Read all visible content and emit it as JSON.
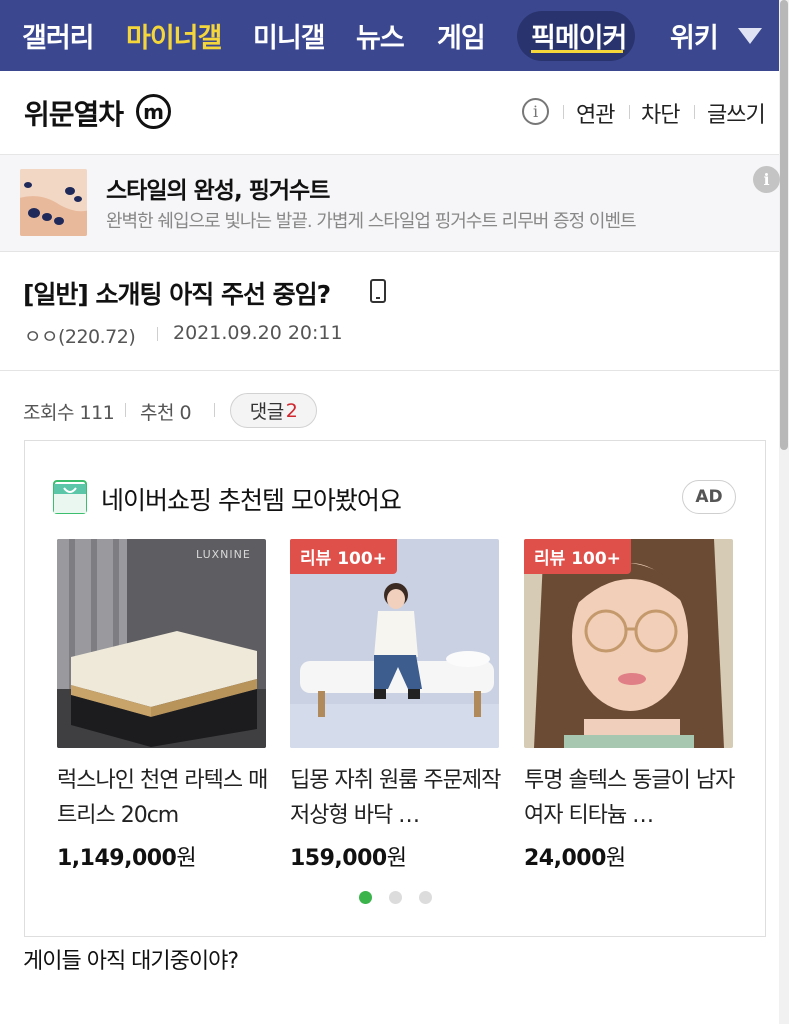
{
  "nav": {
    "items": [
      "갤러리",
      "마이너갤",
      "미니갤",
      "뉴스",
      "게임"
    ],
    "active_item": "마이너갤",
    "pick_label": "픽메이커",
    "wiki_label": "위키",
    "more_icon": "triangle-down-icon"
  },
  "header": {
    "title": "위문열차",
    "badge": "m",
    "links": [
      "연관",
      "차단",
      "글쓰기"
    ]
  },
  "ad_banner": {
    "title": "스타일의 완성, 핑거수트",
    "desc": "완벽한 쉐입으로 빛나는 발끝. 가볍게 스타일업 핑거수트 리무버 증정 이벤트",
    "info": "i"
  },
  "post": {
    "title": "[일반] 소개팅 아직 주선 중임?",
    "author": "ㅇㅇ(220.72)",
    "date": "2021.09.20 20:11",
    "views_label": "조회수 111",
    "recommend_label": "추천 0",
    "comments_label": "댓글",
    "comments_count": "2",
    "body": "게이들 아직 대기중이야?"
  },
  "shopping": {
    "title": "네이버쇼핑 추천템 모아봤어요",
    "ad_badge": "AD",
    "products": [
      {
        "name": "럭스나인 천연 라텍스 매트리스 20cm",
        "price": "1,149,000",
        "unit": "원",
        "brand": "LUXNINE",
        "review_tag": ""
      },
      {
        "name": "딥몽 자취 원룸 주문제작 저상형 바닥 …",
        "price": "159,000",
        "unit": "원",
        "review_tag": "리뷰 100+"
      },
      {
        "name": "투명 솔텍스 동글이 남자 여자 티타늄 …",
        "price": "24,000",
        "unit": "원",
        "review_tag": "리뷰 100+"
      }
    ],
    "page_indicator": {
      "current": 1,
      "total": 3
    }
  },
  "colors": {
    "nav_bg": "#3b4890",
    "nav_active": "#f5d63a",
    "review_tag": "#e0504b",
    "comment_count": "#d0262e",
    "dot_active": "#3ab44b"
  }
}
